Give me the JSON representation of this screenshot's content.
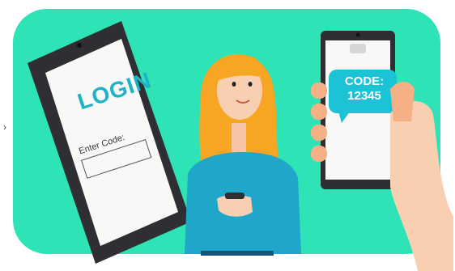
{
  "illustration": {
    "left_phone": {
      "title": "LOGIN",
      "field_label": "Enter Code:"
    },
    "right_phone": {
      "message_line1": "CODE:",
      "message_line2": "12345"
    }
  },
  "colors": {
    "background": "#2ee3b5",
    "accent": "#1db3c7",
    "bubble": "#1cc3d6"
  }
}
